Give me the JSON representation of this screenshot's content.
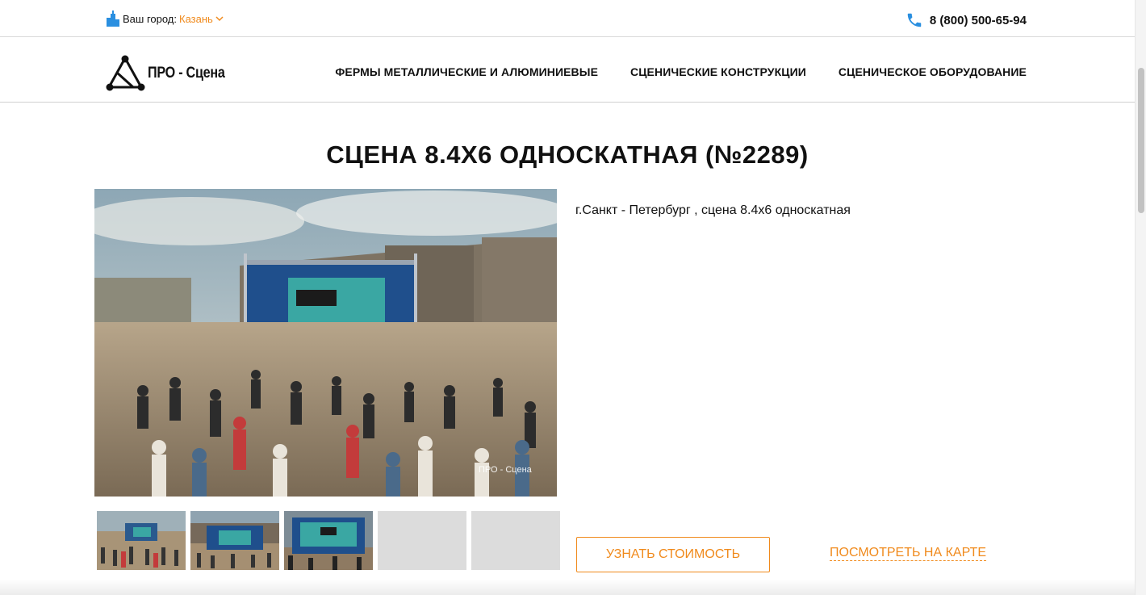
{
  "topbar": {
    "city_label": "Ваш город:",
    "city_value": "Казань",
    "phone": "8 (800) 500-65-94"
  },
  "header": {
    "logo_text": "ПРО - Сцена",
    "nav": [
      "ФЕРМЫ МЕТАЛЛИЧЕСКИЕ И АЛЮМИНИЕВЫЕ",
      "СЦЕНИЧЕСКИЕ КОНСТРУКЦИИ",
      "СЦЕНИЧЕСКОЕ ОБОРУДОВАНИЕ"
    ]
  },
  "product": {
    "title": "СЦЕНА 8.4Х6 ОДНОСКАТНАЯ (№2289)",
    "description": "г.Санкт - Петербург , сцена 8.4х6 односкатная",
    "price_button": "УЗНАТЬ СТОИМОСТЬ",
    "map_link": "ПОСМОТРЕТЬ НА КАРТЕ",
    "photo_watermark": "ПРО - Сцена"
  },
  "colors": {
    "accent": "#f08a1c",
    "phone_icon": "#2a8fe0",
    "text": "#111111"
  },
  "icons": {
    "city": "city-buildings-icon",
    "city_dropdown": "chevron-down-icon",
    "phone": "phone-icon",
    "logo": "triangle-logo-icon"
  }
}
